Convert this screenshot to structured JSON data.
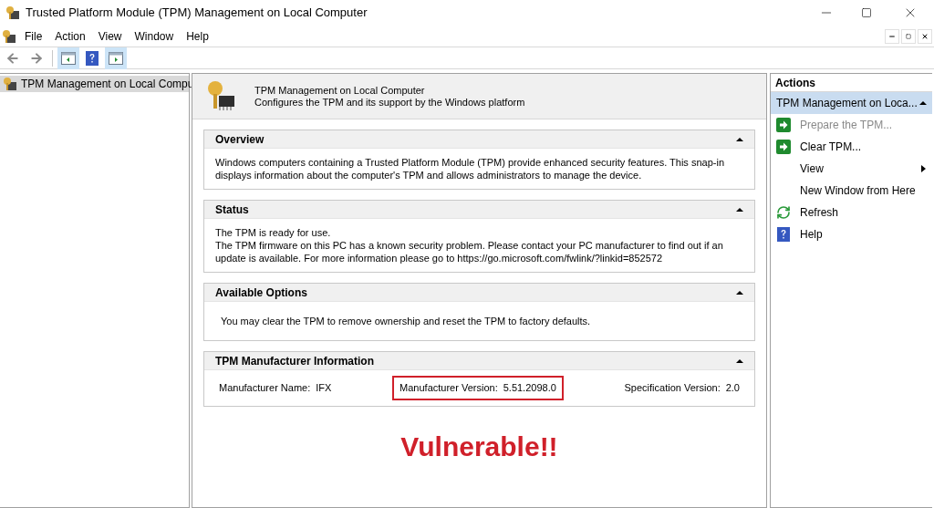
{
  "window": {
    "title": "Trusted Platform Module (TPM) Management on Local Computer"
  },
  "menu": [
    "File",
    "Action",
    "View",
    "Window",
    "Help"
  ],
  "toolbar": [
    {
      "kind": "back",
      "pressed": false
    },
    {
      "kind": "forward",
      "pressed": false
    },
    {
      "kind": "show-tree",
      "pressed": true
    },
    {
      "kind": "help",
      "pressed": false
    },
    {
      "kind": "show-actions",
      "pressed": true
    }
  ],
  "tree": [
    {
      "label": "TPM Management on Local Compu",
      "selected": true
    }
  ],
  "header": {
    "title": "TPM Management on Local Computer",
    "description": "Configures the TPM and its support by the Windows platform"
  },
  "sections": [
    {
      "kind": "text",
      "title": "Overview",
      "expanded": true,
      "paragraphs": [
        "Windows computers containing a Trusted Platform Module (TPM) provide enhanced security features. This snap-in displays information about the computer's TPM and allows administrators to manage the device."
      ]
    },
    {
      "kind": "text",
      "title": "Status",
      "expanded": true,
      "paragraphs": [
        "The TPM is ready for use.",
        "The TPM firmware on this PC has a known security problem. Please contact your PC manufacturer to find out if an update is available. For more information please go to https://go.microsoft.com/fwlink/?linkid=852572"
      ]
    },
    {
      "kind": "options",
      "title": "Available Options",
      "expanded": true,
      "paragraphs": [
        "You may clear the TPM to remove ownership and reset the TPM to factory defaults."
      ]
    },
    {
      "kind": "fields",
      "title": "TPM Manufacturer Information",
      "expanded": true,
      "fields": [
        {
          "label": "Manufacturer Name:",
          "value": "IFX",
          "highlighted": false
        },
        {
          "label": "Manufacturer Version:",
          "value": "5.51.2098.0",
          "highlighted": true
        },
        {
          "label": "Specification Version:",
          "value": "2.0",
          "highlighted": false
        }
      ]
    }
  ],
  "annotation": "Vulnerable!!",
  "actions": {
    "title": "Actions",
    "group": {
      "label": "TPM Management on Loca...",
      "expanded": true
    },
    "items": [
      {
        "label": "Prepare the TPM...",
        "kind": "run",
        "disabled": true,
        "submenu": false
      },
      {
        "label": "Clear TPM...",
        "kind": "run",
        "disabled": false,
        "submenu": false
      },
      {
        "label": "View",
        "kind": "plain",
        "disabled": false,
        "submenu": true
      },
      {
        "label": "New Window from Here",
        "kind": "plain",
        "disabled": false,
        "submenu": false
      },
      {
        "label": "Refresh",
        "kind": "refresh",
        "disabled": false,
        "submenu": false
      },
      {
        "label": "Help",
        "kind": "help",
        "disabled": false,
        "submenu": false
      }
    ]
  }
}
